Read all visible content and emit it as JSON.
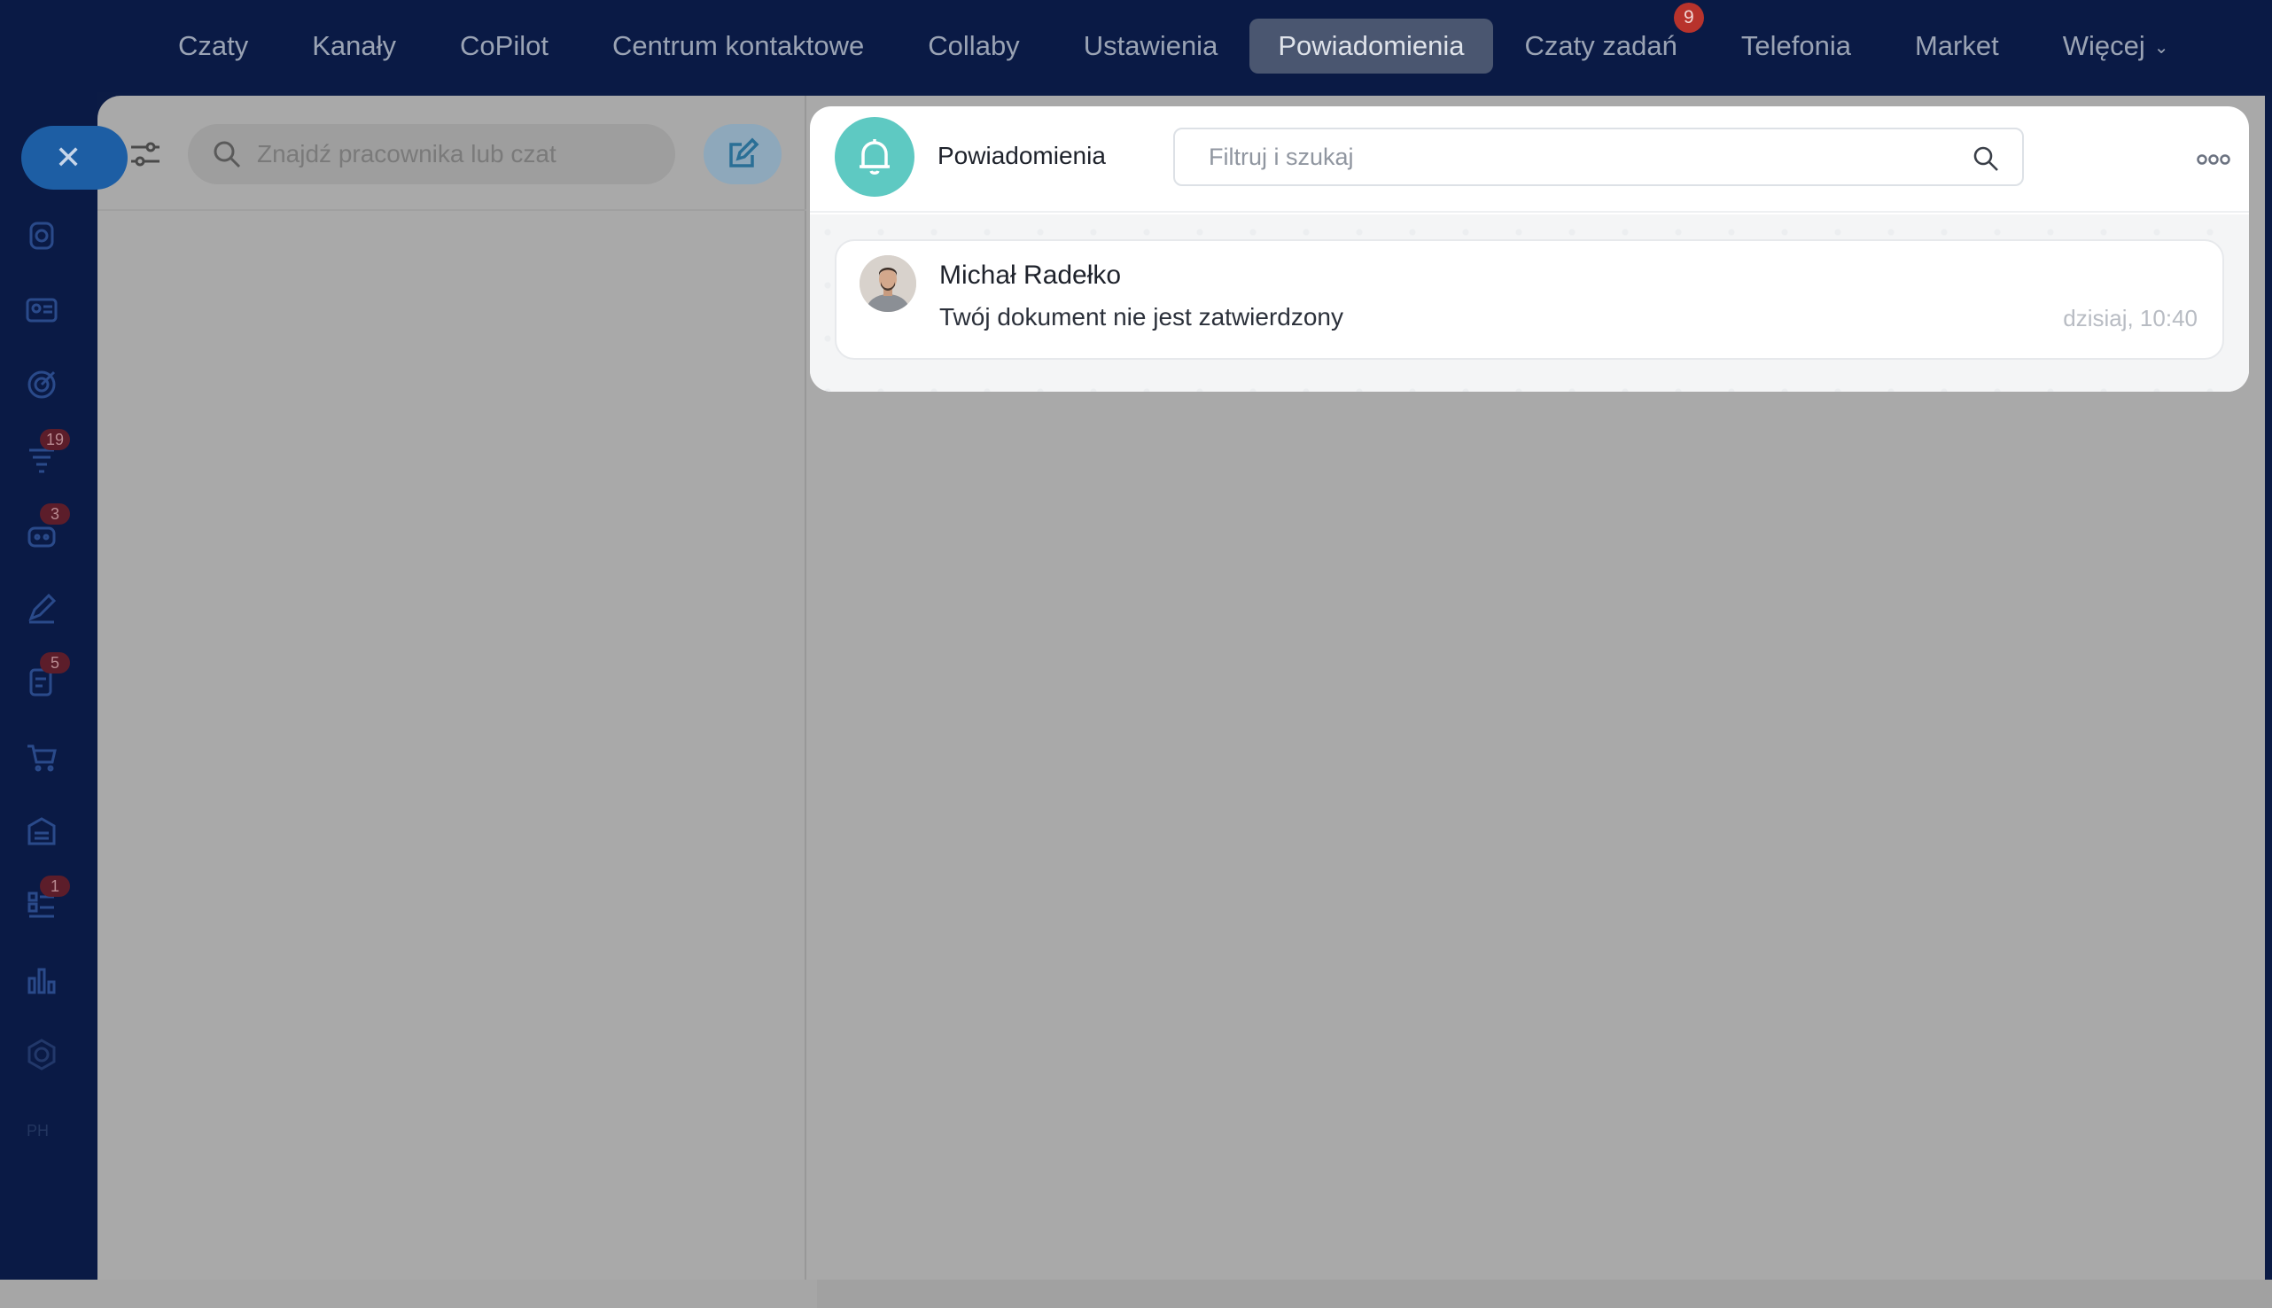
{
  "topnav": {
    "items": [
      {
        "label": "Czaty"
      },
      {
        "label": "Kanały"
      },
      {
        "label": "CoPilot"
      },
      {
        "label": "Centrum kontaktowe"
      },
      {
        "label": "Collaby"
      },
      {
        "label": "Ustawienia"
      },
      {
        "label": "Powiadomienia",
        "active": true
      },
      {
        "label": "Czaty zadań",
        "badge": "9"
      },
      {
        "label": "Telefonia"
      },
      {
        "label": "Market"
      },
      {
        "label": "Więcej"
      }
    ]
  },
  "rail": {
    "badges": {
      "b1": "19",
      "b2": "3",
      "b3": "5",
      "b4": "1"
    },
    "footer_text": "PH"
  },
  "left": {
    "search_placeholder": "Znajdź pracownika lub czat"
  },
  "popup": {
    "title": "Powiadomienia",
    "search_placeholder": "Filtruj i szukaj",
    "notification": {
      "name": "Michał Radełko",
      "text": "Twój dokument nie jest zatwierdzony",
      "time": "dzisiaj, 10:40"
    }
  },
  "colors": {
    "accent": "#5ec9c2",
    "nav_bg": "#0a1a45",
    "badge": "#b8332c"
  }
}
